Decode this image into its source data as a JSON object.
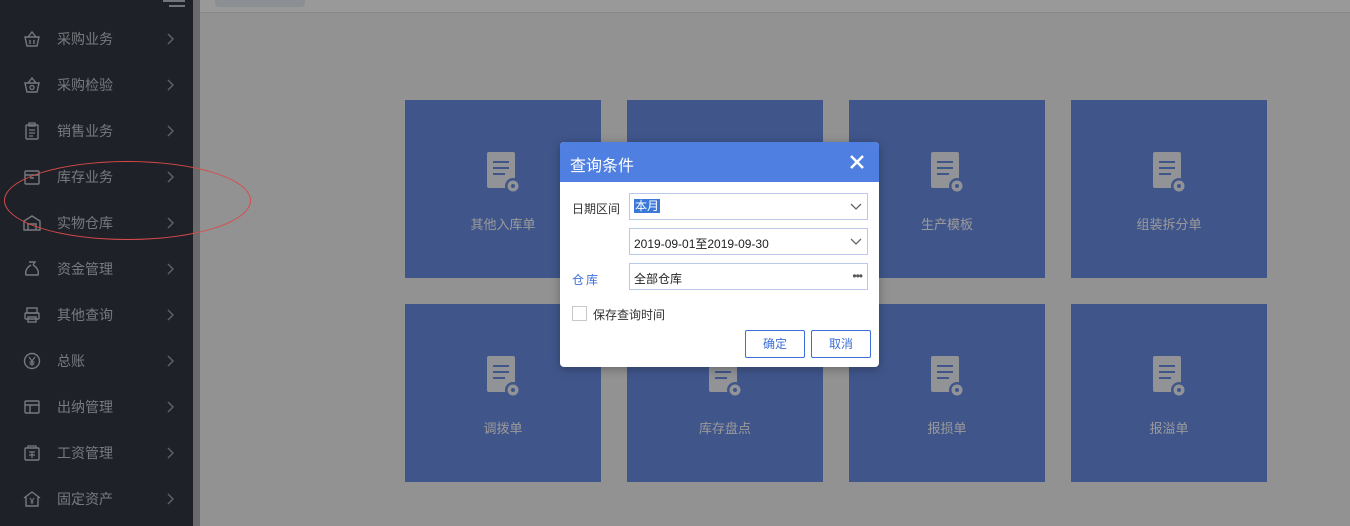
{
  "sidebar": {
    "items": [
      {
        "label": "采购业务",
        "icon": "basket-icon"
      },
      {
        "label": "采购检验",
        "icon": "inspection-basket-icon"
      },
      {
        "label": "销售业务",
        "icon": "clipboard-icon"
      },
      {
        "label": "库存业务",
        "icon": "inventory-box-icon"
      },
      {
        "label": "实物仓库",
        "icon": "warehouse-icon"
      },
      {
        "label": "资金管理",
        "icon": "money-bag-icon"
      },
      {
        "label": "其他查询",
        "icon": "printer-icon"
      },
      {
        "label": "总账",
        "icon": "yen-icon"
      },
      {
        "label": "出纳管理",
        "icon": "layout-icon"
      },
      {
        "label": "工资管理",
        "icon": "payroll-icon"
      },
      {
        "label": "固定资产",
        "icon": "house-yen-icon"
      }
    ]
  },
  "tiles": [
    {
      "label": "其他入库单"
    },
    {
      "label": ""
    },
    {
      "label": "生产模板"
    },
    {
      "label": "组装拆分单"
    },
    {
      "label": "调拨单"
    },
    {
      "label": "库存盘点"
    },
    {
      "label": "报损单"
    },
    {
      "label": "报溢单"
    }
  ],
  "dialog": {
    "title": "查询条件",
    "date_range_label": "日期区间",
    "period_value": "本月",
    "date_range_value": "2019-09-01至2019-09-30",
    "warehouse_label": "仓库",
    "warehouse_value": "全部仓库",
    "save_time_label": "保存查询时间",
    "save_time_checked": false,
    "confirm_label": "确定",
    "cancel_label": "取消"
  },
  "colors": {
    "sidebar_bg": "#333842",
    "tile_bg": "#6c8fe8",
    "dialog_header": "#4f7fe0",
    "annotation": "#d94a4a"
  }
}
